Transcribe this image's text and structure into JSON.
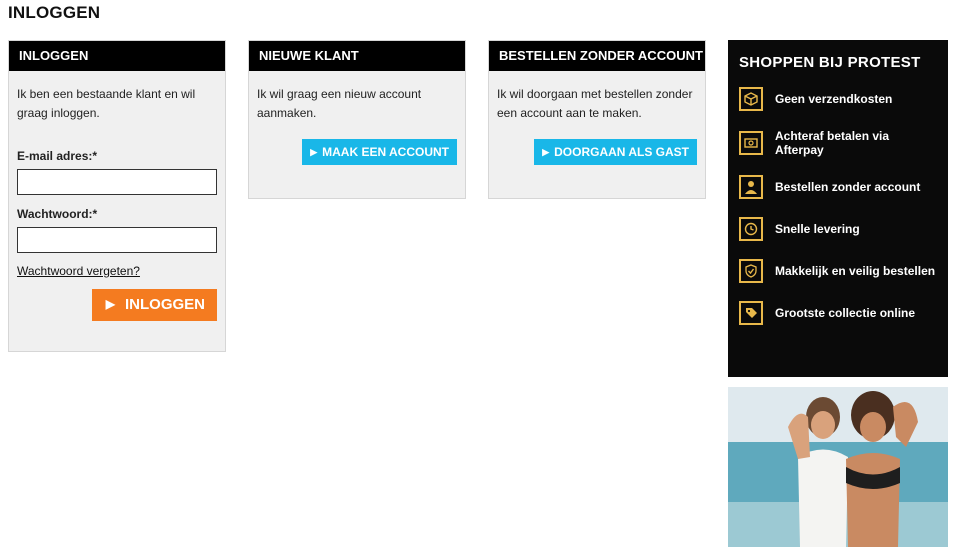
{
  "page": {
    "title": "INLOGGEN"
  },
  "login_panel": {
    "header": "INLOGGEN",
    "intro": "Ik ben een bestaande klant en wil graag inloggen.",
    "email_label": "E-mail adres:*",
    "email_value": "",
    "password_label": "Wachtwoord:*",
    "password_value": "",
    "forgot_link": "Wachtwoord vergeten?",
    "submit_label": "INLOGGEN"
  },
  "new_customer_panel": {
    "header": "NIEUWE KLANT",
    "intro": "Ik wil graag een nieuw account aanmaken.",
    "button_label": "MAAK EEN ACCOUNT"
  },
  "guest_panel": {
    "header": "BESTELLEN ZONDER ACCOUNT",
    "intro": "Ik wil doorgaan met bestellen zonder een account aan te maken.",
    "button_label": "DOORGAAN ALS GAST"
  },
  "promo": {
    "title": "SHOPPEN BIJ PROTEST",
    "items": [
      {
        "icon": "box-icon",
        "label": "Geen verzendkosten"
      },
      {
        "icon": "money-icon",
        "label": "Achteraf betalen via Afterpay"
      },
      {
        "icon": "person-icon",
        "label": "Bestellen zonder account"
      },
      {
        "icon": "clock-icon",
        "label": "Snelle levering"
      },
      {
        "icon": "shield-check-icon",
        "label": "Makkelijk en veilig bestellen"
      },
      {
        "icon": "tag-icon",
        "label": "Grootste collectie online"
      }
    ]
  },
  "colors": {
    "accent_blue": "#19b7e8",
    "accent_orange": "#f47b20",
    "icon_gold": "#e8b84a",
    "header_black": "#000000"
  }
}
